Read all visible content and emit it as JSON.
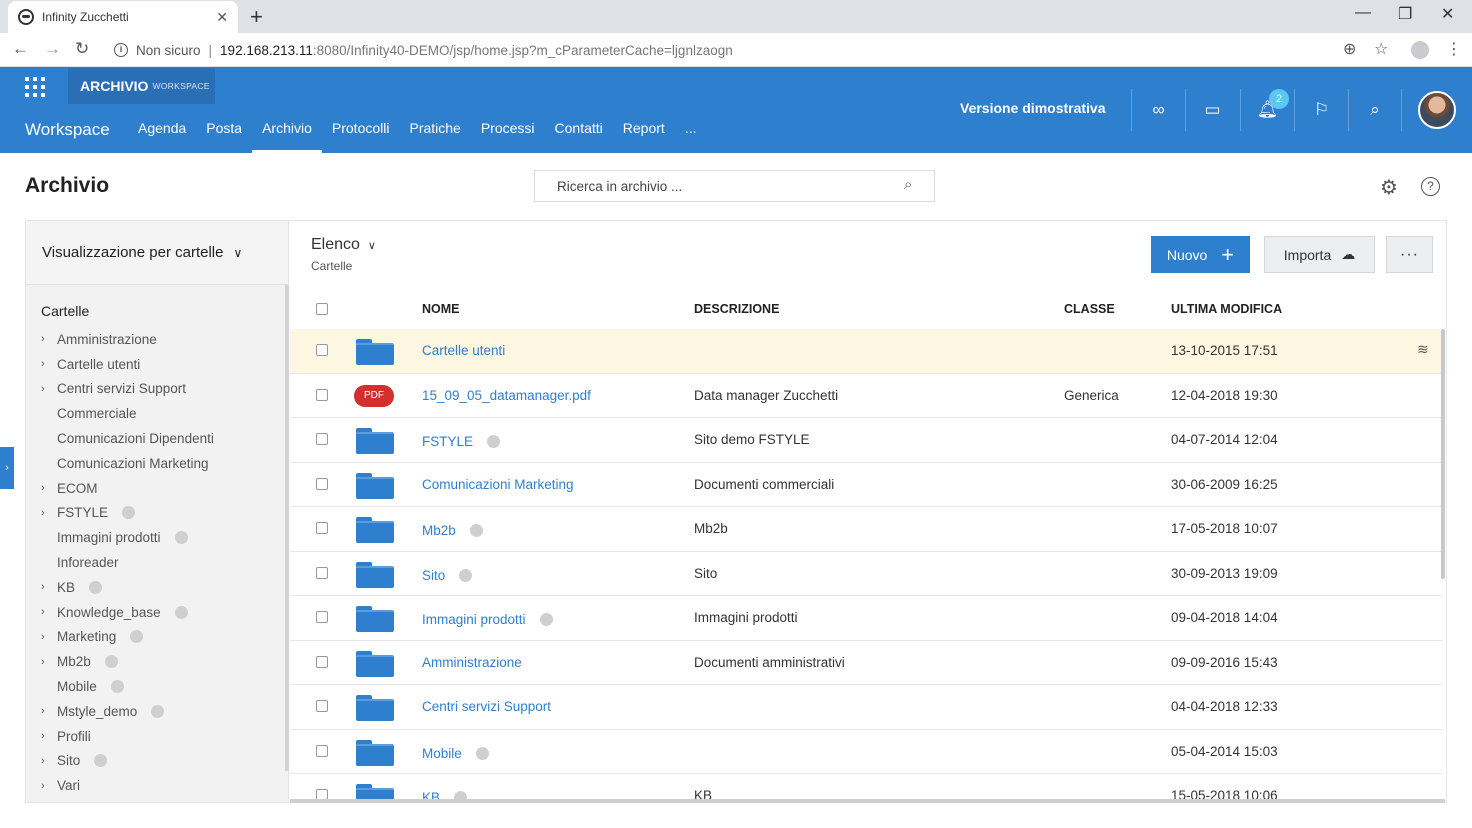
{
  "browser": {
    "tab_title": "Infinity Zucchetti",
    "tab_close": "✕",
    "new_tab": "+",
    "security_label": "Non sicuro",
    "url_host": "192.168.213.11",
    "url_path": ":8080/Infinity40-DEMO/jsp/home.jsp?m_cParameterCache=ljgnlzaogn"
  },
  "header": {
    "workspace_chip": "ARCHIVIO",
    "workspace_chip_sub": "WORKSPACE",
    "brand": "Workspace",
    "nav": [
      "Agenda",
      "Posta",
      "Archivio",
      "Protocolli",
      "Pratiche",
      "Processi",
      "Contatti",
      "Report",
      "..."
    ],
    "demo_label": "Versione dimostrativa",
    "notification_count": "2"
  },
  "page": {
    "title": "Archivio",
    "search_placeholder": "Ricerca in archivio ..."
  },
  "left_panel": {
    "view_select": "Visualizzazione per cartelle",
    "root": "Cartelle",
    "items": [
      {
        "label": "Amministrazione",
        "expandable": true,
        "shared": false
      },
      {
        "label": "Cartelle utenti",
        "expandable": true,
        "shared": false
      },
      {
        "label": "Centri servizi Support",
        "expandable": true,
        "shared": false
      },
      {
        "label": "Commerciale",
        "expandable": false,
        "shared": false
      },
      {
        "label": "Comunicazioni Dipendenti",
        "expandable": false,
        "shared": false
      },
      {
        "label": "Comunicazioni Marketing",
        "expandable": false,
        "shared": false
      },
      {
        "label": "ECOM",
        "expandable": true,
        "shared": false
      },
      {
        "label": "FSTYLE",
        "expandable": true,
        "shared": true
      },
      {
        "label": "Immagini prodotti",
        "expandable": false,
        "shared": true
      },
      {
        "label": "Inforeader",
        "expandable": false,
        "shared": false
      },
      {
        "label": "KB",
        "expandable": true,
        "shared": true
      },
      {
        "label": "Knowledge_base",
        "expandable": true,
        "shared": true
      },
      {
        "label": "Marketing",
        "expandable": true,
        "shared": true
      },
      {
        "label": "Mb2b",
        "expandable": true,
        "shared": true
      },
      {
        "label": "Mobile",
        "expandable": false,
        "shared": true
      },
      {
        "label": "Mstyle_demo",
        "expandable": true,
        "shared": true
      },
      {
        "label": "Profili",
        "expandable": true,
        "shared": false
      },
      {
        "label": "Sito",
        "expandable": true,
        "shared": true
      },
      {
        "label": "Vari",
        "expandable": true,
        "shared": false
      }
    ]
  },
  "content": {
    "view_label": "Elenco",
    "view_sub": "Cartelle",
    "btn_nuovo": "Nuovo",
    "btn_importa": "Importa",
    "btn_more": "···",
    "columns": {
      "name": "NOME",
      "description": "DESCRIZIONE",
      "class": "CLASSE",
      "modified": "ULTIMA MODIFICA"
    },
    "rows": [
      {
        "type": "folder",
        "name": "Cartelle utenti",
        "shared": false,
        "description": "",
        "class": "",
        "modified": "13-10-2015 17:51",
        "highlight": true
      },
      {
        "type": "pdf",
        "name": "15_09_05_datamanager.pdf",
        "shared": false,
        "description": "Data manager Zucchetti",
        "class": "Generica",
        "modified": "12-04-2018 19:30",
        "highlight": false
      },
      {
        "type": "folder",
        "name": "FSTYLE",
        "shared": true,
        "description": "Sito demo FSTYLE",
        "class": "",
        "modified": "04-07-2014 12:04",
        "highlight": false
      },
      {
        "type": "folder",
        "name": "Comunicazioni Marketing",
        "shared": false,
        "description": "Documenti commerciali",
        "class": "",
        "modified": "30-06-2009 16:25",
        "highlight": false
      },
      {
        "type": "folder",
        "name": "Mb2b",
        "shared": true,
        "description": "Mb2b",
        "class": "",
        "modified": "17-05-2018 10:07",
        "highlight": false
      },
      {
        "type": "folder",
        "name": "Sito",
        "shared": true,
        "description": "Sito",
        "class": "",
        "modified": "30-09-2013 19:09",
        "highlight": false
      },
      {
        "type": "folder",
        "name": "Immagini prodotti",
        "shared": true,
        "description": "Immagini prodotti",
        "class": "",
        "modified": "09-04-2018 14:04",
        "highlight": false
      },
      {
        "type": "folder",
        "name": "Amministrazione",
        "shared": false,
        "description": "Documenti amministrativi",
        "class": "",
        "modified": "09-09-2016 15:43",
        "highlight": false
      },
      {
        "type": "folder",
        "name": "Centri servizi Support",
        "shared": false,
        "description": "",
        "class": "",
        "modified": "04-04-2018 12:33",
        "highlight": false
      },
      {
        "type": "folder",
        "name": "Mobile",
        "shared": true,
        "description": "",
        "class": "",
        "modified": "05-04-2014 15:03",
        "highlight": false
      },
      {
        "type": "folder",
        "name": "KB",
        "shared": true,
        "description": "KB",
        "class": "",
        "modified": "15-05-2018 10:06",
        "highlight": false
      }
    ]
  },
  "colors": {
    "accent": "#2f7fcf",
    "highlight_row": "#fdf6e1",
    "pdf": "#d32f2f"
  }
}
